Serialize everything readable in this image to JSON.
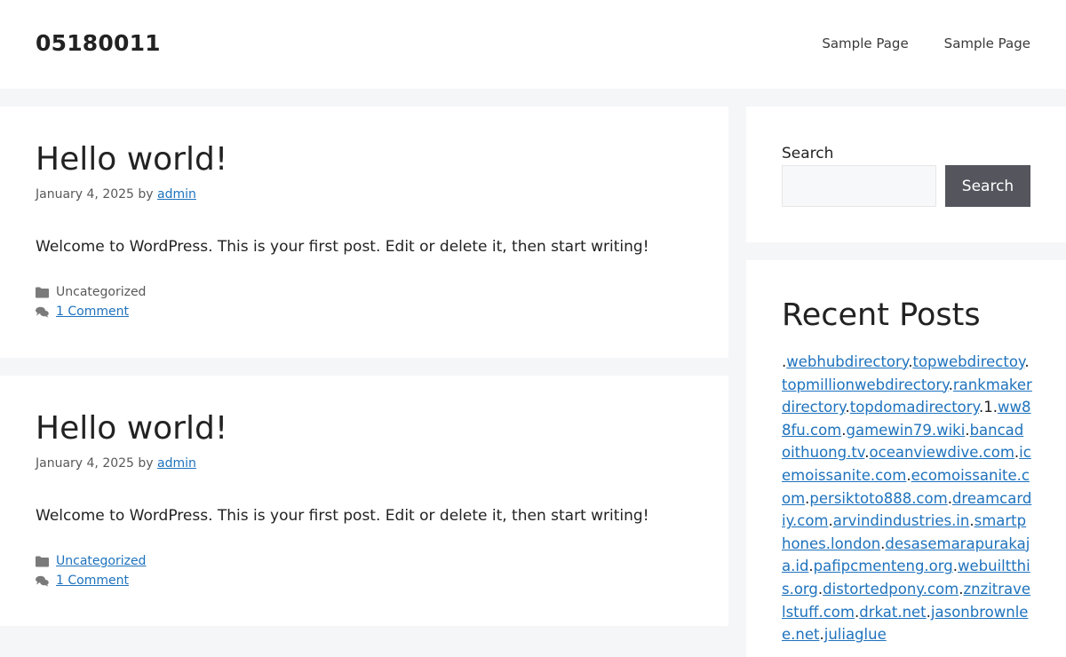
{
  "header": {
    "site_title": "05180011",
    "nav": [
      "Sample Page",
      "Sample Page"
    ]
  },
  "posts": [
    {
      "title": "Hello world!",
      "date": "January 4, 2025",
      "by": "by",
      "author": "admin",
      "excerpt": "Welcome to WordPress. This is your first post. Edit or delete it, then start writing!",
      "category": "Uncategorized",
      "comments": "1 Comment"
    },
    {
      "title": "Hello world!",
      "date": "January 4, 2025",
      "by": "by",
      "author": "admin",
      "excerpt": "Welcome to WordPress. This is your first post. Edit or delete it, then start writing!",
      "category": "Uncategorized",
      "comments": "1 Comment"
    }
  ],
  "sidebar": {
    "search_label": "Search",
    "search_button": "Search",
    "recent_title": "Recent Posts",
    "recent_links": [
      ".",
      "webhubdirectory",
      ".",
      "topwebdirectoy",
      ".",
      "topmillionwebdirectory",
      ".",
      "rankmakerdirectory",
      ".",
      "topdomadirectory",
      ".1.",
      "ww88fu.com",
      ".",
      "gamewin79.wiki",
      ".",
      "bancadoithuong.tv",
      ".",
      "oceanviewdive.com",
      ".",
      "icemoissanite.com",
      ".",
      "ecomoissanite.com",
      ".",
      "persiktoto888.com",
      ".",
      "dreamcardiy.com",
      ".",
      "arvindindustries.in",
      ".",
      "smartphones.london",
      ".",
      "desasemarapurakaja.id",
      ".",
      "pafipcmenteng.org",
      ".",
      "webuiltthis.org",
      ".",
      "distortedpony.com",
      ".",
      "znzitravelstuff.com",
      ".",
      "drkat.net",
      ".",
      "jasonbrownlee.net",
      ".",
      "juliaglue"
    ]
  },
  "colors": {
    "link": "#1e72bd",
    "button": "#55555e",
    "background": "#f5f6f8"
  }
}
